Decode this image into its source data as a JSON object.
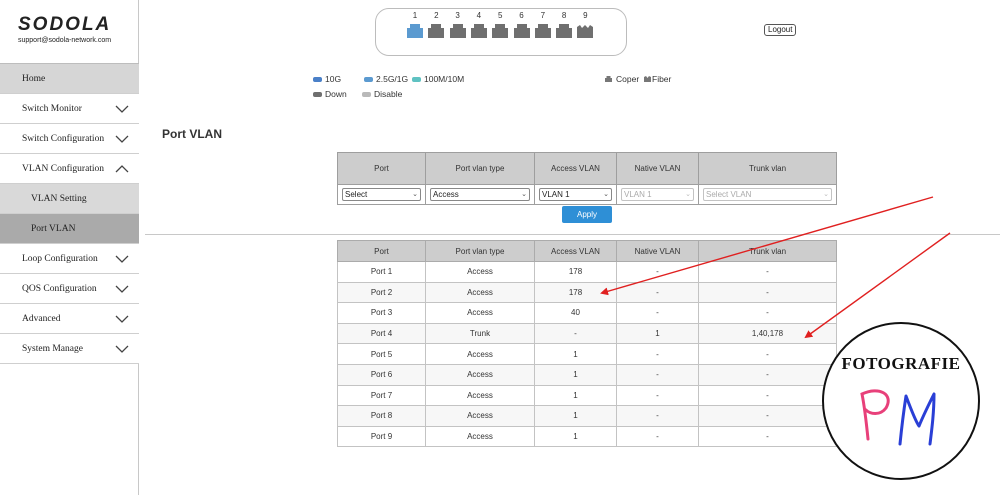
{
  "brand": {
    "logo": "SODOLA",
    "email": "support@sodola-network.com"
  },
  "header": {
    "ports": [
      "1",
      "2",
      "3",
      "4",
      "5",
      "6",
      "7",
      "8",
      "9"
    ],
    "port_states": [
      "2.5G/1G",
      "Down",
      "Down",
      "Down",
      "Down",
      "Down",
      "Down",
      "Down",
      "Fiber"
    ],
    "logout_label": "Logout"
  },
  "legend": {
    "items": [
      {
        "label": "10G",
        "color": "#4a80c8"
      },
      {
        "label": "2.5G/1G",
        "color": "#5b9ad0"
      },
      {
        "label": "100M/10M",
        "color": "#5fc2c2"
      },
      {
        "label": "Down",
        "color": "#6f6f6f"
      },
      {
        "label": "Disable",
        "color": "#b9b9b9"
      }
    ],
    "coper": "Coper",
    "fiber": "Fiber"
  },
  "sidebar": {
    "items": [
      {
        "label": "Home",
        "type": "home"
      },
      {
        "label": "Switch Monitor",
        "type": "group",
        "expanded": false
      },
      {
        "label": "Switch Configuration",
        "type": "group",
        "expanded": false
      },
      {
        "label": "VLAN Configuration",
        "type": "group",
        "expanded": true
      },
      {
        "label": "VLAN Setting",
        "type": "sub",
        "active": false
      },
      {
        "label": "Port VLAN",
        "type": "sub",
        "active": true
      },
      {
        "label": "Loop Configuration",
        "type": "group",
        "expanded": false
      },
      {
        "label": "QOS Configuration",
        "type": "group",
        "expanded": false
      },
      {
        "label": "Advanced",
        "type": "group",
        "expanded": false
      },
      {
        "label": "System Manage",
        "type": "group",
        "expanded": false
      }
    ]
  },
  "page": {
    "title": "Port VLAN"
  },
  "config": {
    "headers": [
      "Port",
      "Port vlan type",
      "Access VLAN",
      "Native VLAN",
      "Trunk vlan"
    ],
    "selects": [
      {
        "value": "Select",
        "disabled": false
      },
      {
        "value": "Access",
        "disabled": false
      },
      {
        "value": "VLAN 1",
        "disabled": false
      },
      {
        "value": "VLAN 1",
        "disabled": true
      },
      {
        "value": "Select VLAN",
        "disabled": true
      }
    ],
    "apply_label": "Apply"
  },
  "port_table": {
    "headers": [
      "Port",
      "Port vlan type",
      "Access VLAN",
      "Native VLAN",
      "Trunk vlan"
    ],
    "rows": [
      [
        "Port 1",
        "Access",
        "178",
        "-",
        "-"
      ],
      [
        "Port 2",
        "Access",
        "178",
        "-",
        "-"
      ],
      [
        "Port 3",
        "Access",
        "40",
        "-",
        "-"
      ],
      [
        "Port 4",
        "Trunk",
        "-",
        "1",
        "1,40,178"
      ],
      [
        "Port 5",
        "Access",
        "1",
        "-",
        "-"
      ],
      [
        "Port 6",
        "Access",
        "1",
        "-",
        "-"
      ],
      [
        "Port 7",
        "Access",
        "1",
        "-",
        "-"
      ],
      [
        "Port 8",
        "Access",
        "1",
        "-",
        "-"
      ],
      [
        "Port 9",
        "Access",
        "1",
        "-",
        "-"
      ]
    ]
  },
  "watermark": {
    "title": "FOTOGRAFIE",
    "signature": "PM"
  },
  "colors": {
    "accent": "#2e8fd6",
    "arrow": "#e02020",
    "port_active": "#5b9ad0",
    "port_down": "#6f6f6f"
  }
}
